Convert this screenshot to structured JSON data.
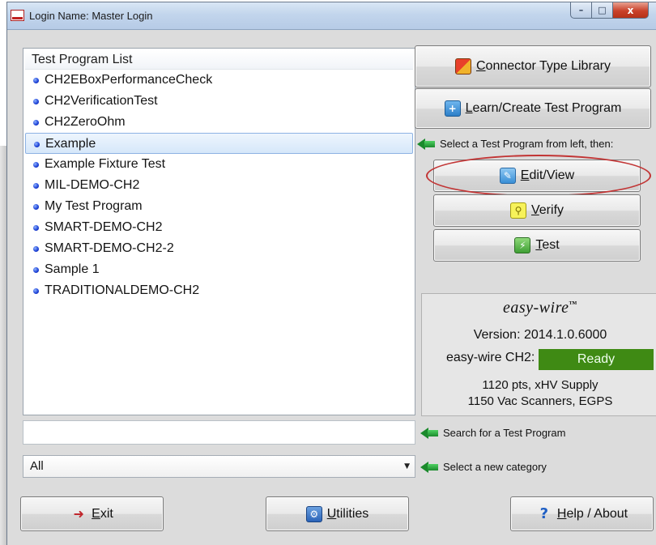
{
  "window": {
    "title": "Login Name: Master Login",
    "app_icon_text": "easy wire",
    "caption": {
      "minimize": "–",
      "maximize": "□",
      "close": "x"
    }
  },
  "program_list": {
    "header": "Test Program List",
    "items": [
      "CH2EBoxPerformanceCheck",
      "CH2VerificationTest",
      "CH2ZeroOhm",
      "Example",
      "Example Fixture Test",
      "MIL-DEMO-CH2",
      "My Test Program",
      "SMART-DEMO-CH2",
      "SMART-DEMO-CH2-2",
      "Sample 1",
      "TRADITIONALDEMO-CH2"
    ],
    "selected_index": 3
  },
  "search": {
    "value": "",
    "hint": "Search for a Test Program"
  },
  "category": {
    "selected": "All",
    "hint": "Select a new category"
  },
  "actions": {
    "connector_library": {
      "mnemonic": "C",
      "rest": "onnector Type Library"
    },
    "learn_create": {
      "mnemonic": "L",
      "rest": "earn/Create Test Program"
    },
    "select_hint": "Select a Test Program from left, then:",
    "edit_view": {
      "mnemonic": "E",
      "rest": "dit/View"
    },
    "verify": {
      "mnemonic": "V",
      "rest": "erify"
    },
    "test": {
      "mnemonic": "T",
      "rest": "est"
    }
  },
  "info": {
    "brand": "easy-wire",
    "brand_mark": "™",
    "version_label": "Version:",
    "version_value": "2014.1.0.6000",
    "status_label": "easy-wire CH2:",
    "status_value": "Ready",
    "line1": "1120 pts, xHV Supply",
    "line2": "1150 Vac Scanners, EGPS"
  },
  "footer": {
    "exit": {
      "mnemonic": "E",
      "rest": "xit"
    },
    "utilities": {
      "mnemonic": "U",
      "rest": "tilities"
    },
    "help": {
      "mnemonic": "H",
      "rest": "elp / About"
    }
  },
  "colors": {
    "status_ready": "#3f8a14",
    "arrow": "#1b8a2c",
    "selection": "#d6e7fa",
    "highlight_ring": "#c23535"
  },
  "icons": {
    "exit": "exit-door-icon",
    "utilities": "utilities-icon",
    "help": "question-mark-icon",
    "connector": "connector-library-icon",
    "learn": "learn-create-icon",
    "edit": "edit-pencil-icon",
    "verify": "verify-magnifier-icon",
    "test": "test-run-icon"
  }
}
